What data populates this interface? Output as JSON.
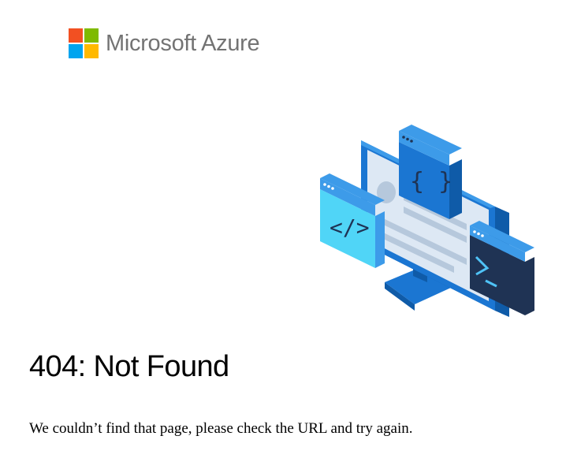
{
  "brand": {
    "name": "Microsoft Azure",
    "logo_icon": "microsoft-logo-icon",
    "logo_colors": {
      "red": "#f25022",
      "green": "#7fba00",
      "blue": "#00a4ef",
      "yellow": "#ffb900"
    },
    "text_color": "#737373"
  },
  "illustration": {
    "icon": "computer-code-illustration-icon",
    "colors": {
      "frame_dark": "#0f5ba8",
      "frame_mid": "#1b76d2",
      "frame_light": "#3d9be9",
      "screen": "#dde8f4",
      "screen_lines": "#b6c8dc",
      "cyan_panel": "#50d5f7",
      "dark_panel": "#1f3354",
      "accent_line": "#4fc3f7"
    }
  },
  "error": {
    "title": "404: Not Found",
    "message": "We couldn’t find that page, please check the URL and try again."
  }
}
